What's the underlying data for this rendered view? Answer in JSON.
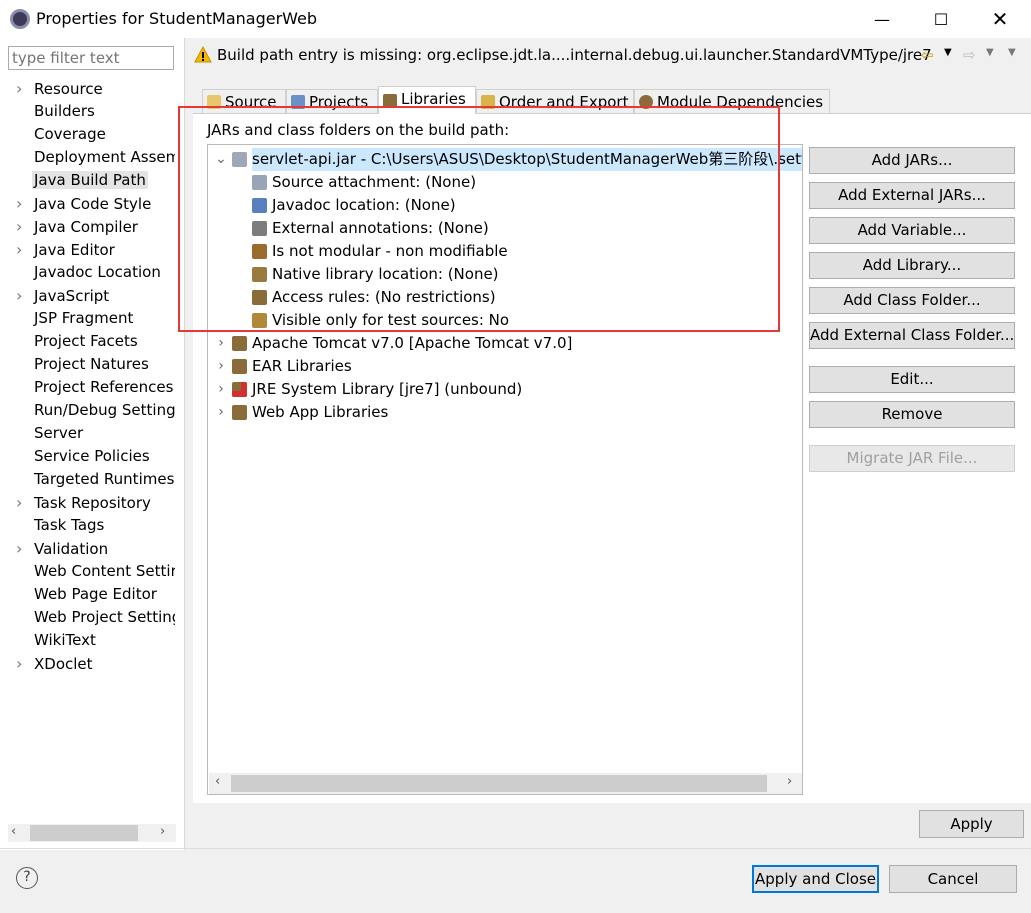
{
  "window": {
    "title": "Properties for StudentManagerWeb",
    "controls": [
      "minimize-icon",
      "maximize-icon",
      "close-icon"
    ]
  },
  "left": {
    "filter_placeholder": "type filter text",
    "items": [
      {
        "label": "Resource",
        "expandable": true
      },
      {
        "label": "Builders",
        "expandable": false
      },
      {
        "label": "Coverage",
        "expandable": false
      },
      {
        "label": "Deployment Assem",
        "expandable": false
      },
      {
        "label": "Java Build Path",
        "expandable": false,
        "selected": true
      },
      {
        "label": "Java Code Style",
        "expandable": true
      },
      {
        "label": "Java Compiler",
        "expandable": true
      },
      {
        "label": "Java Editor",
        "expandable": true
      },
      {
        "label": "Javadoc Location",
        "expandable": false
      },
      {
        "label": "JavaScript",
        "expandable": true
      },
      {
        "label": "JSP Fragment",
        "expandable": false
      },
      {
        "label": "Project Facets",
        "expandable": false
      },
      {
        "label": "Project Natures",
        "expandable": false
      },
      {
        "label": "Project References",
        "expandable": false
      },
      {
        "label": "Run/Debug Setting",
        "expandable": false
      },
      {
        "label": "Server",
        "expandable": false
      },
      {
        "label": "Service Policies",
        "expandable": false
      },
      {
        "label": "Targeted Runtimes",
        "expandable": false
      },
      {
        "label": "Task Repository",
        "expandable": true
      },
      {
        "label": "Task Tags",
        "expandable": false
      },
      {
        "label": "Validation",
        "expandable": true
      },
      {
        "label": "Web Content Settir",
        "expandable": false
      },
      {
        "label": "Web Page Editor",
        "expandable": false
      },
      {
        "label": "Web Project Setting",
        "expandable": false
      },
      {
        "label": "WikiText",
        "expandable": false
      },
      {
        "label": "XDoclet",
        "expandable": true
      }
    ]
  },
  "warning": {
    "text": "Build path entry is missing: org.eclipse.jdt.la....internal.debug.ui.launcher.StandardVMType/jre7"
  },
  "tabs": [
    {
      "label": "Source",
      "active": false,
      "icon": "source-folder-icon"
    },
    {
      "label": "Projects",
      "active": false,
      "icon": "projects-icon"
    },
    {
      "label": "Libraries",
      "active": true,
      "icon": "libraries-icon"
    },
    {
      "label": "Order and Export",
      "active": false,
      "icon": "order-export-icon"
    },
    {
      "label": "Module Dependencies",
      "active": false,
      "icon": "module-dependencies-icon"
    }
  ],
  "libraries": {
    "heading": "JARs and class folders on the build path:",
    "tree": [
      {
        "label": "servlet-api.jar - C:\\Users\\ASUS\\Desktop\\StudentManagerWeb第三阶段\\.sett",
        "level": 0,
        "expanded": true,
        "selected": true,
        "icon": "jar-icon"
      },
      {
        "label": "Source attachment: (None)",
        "level": 1,
        "icon": "source-attachment-icon"
      },
      {
        "label": "Javadoc location: (None)",
        "level": 1,
        "icon": "javadoc-icon"
      },
      {
        "label": "External annotations: (None)",
        "level": 1,
        "icon": "annotations-icon"
      },
      {
        "label": "Is not modular - non modifiable",
        "level": 1,
        "icon": "module-icon"
      },
      {
        "label": "Native library location: (None)",
        "level": 1,
        "icon": "native-library-icon"
      },
      {
        "label": "Access rules: (No restrictions)",
        "level": 1,
        "icon": "access-rules-icon"
      },
      {
        "label": "Visible only for test sources: No",
        "level": 1,
        "icon": "test-sources-icon"
      },
      {
        "label": "Apache Tomcat v7.0 [Apache Tomcat v7.0]",
        "level": 0,
        "expanded": false,
        "icon": "library-icon"
      },
      {
        "label": "EAR Libraries",
        "level": 0,
        "expanded": false,
        "icon": "library-icon"
      },
      {
        "label": "JRE System Library [jre7] (unbound)",
        "level": 0,
        "expanded": false,
        "icon": "jre-library-error-icon"
      },
      {
        "label": "Web App Libraries",
        "level": 0,
        "expanded": false,
        "icon": "library-icon"
      }
    ]
  },
  "buttons": {
    "add_jars": "Add JARs...",
    "add_external_jars": "Add External JARs...",
    "add_variable": "Add Variable...",
    "add_library": "Add Library...",
    "add_class_folder": "Add Class Folder...",
    "add_external_class_folder": "Add External Class Folder...",
    "edit": "Edit...",
    "remove": "Remove",
    "migrate_jar": "Migrate JAR File...",
    "apply": "Apply",
    "apply_and_close": "Apply and Close",
    "cancel": "Cancel"
  },
  "colors": {
    "selection": "#cce8ff",
    "highlight_box": "#e53935",
    "warning": "#f5b800"
  }
}
